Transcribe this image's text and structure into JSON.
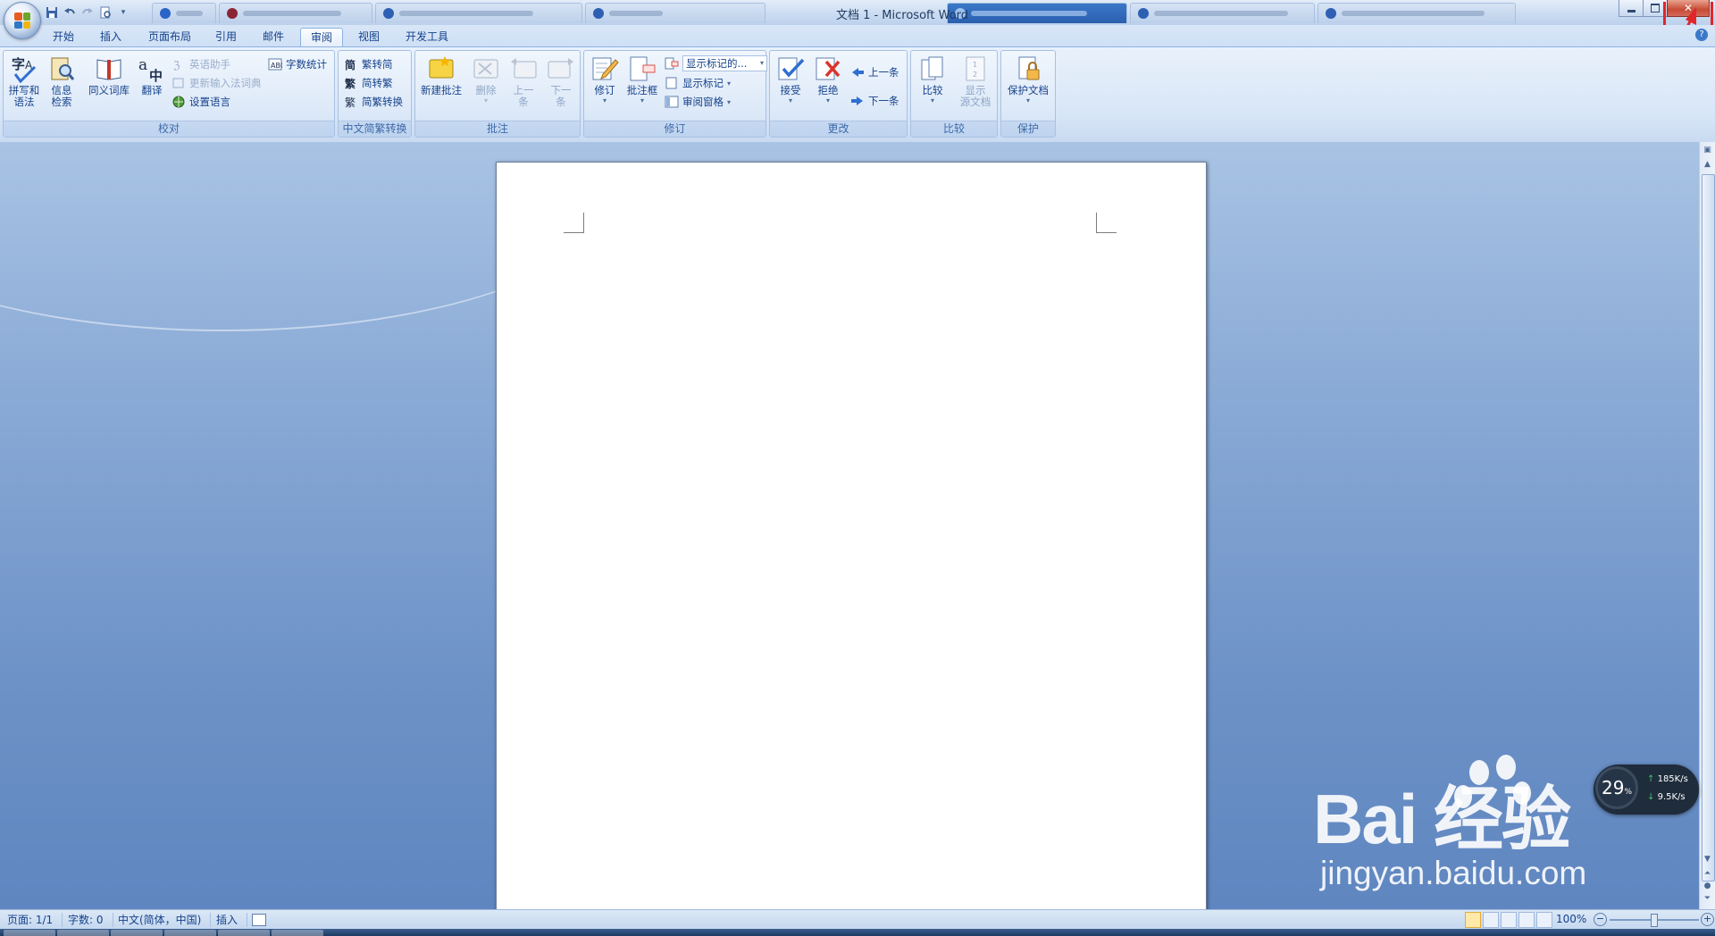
{
  "window": {
    "title": "文档 1 - Microsoft Word"
  },
  "tabs": [
    "开始",
    "插入",
    "页面布局",
    "引用",
    "邮件",
    "审阅",
    "视图",
    "开发工具"
  ],
  "active_tab": "审阅",
  "ribbon": {
    "proofing": {
      "label": "校对",
      "spelling": "拼写和\n语法",
      "research": "信息\n检索",
      "thesaurus": "同义词库",
      "translate": "翻译",
      "english_assistant": "英语助手",
      "update_ime": "更新输入法词典",
      "set_language": "设置语言",
      "word_count": "字数统计"
    },
    "chinese_conversion": {
      "label": "中文简繁转换",
      "to_simplified": "繁转简",
      "to_traditional": "简转繁",
      "conversion": "简繁转换"
    },
    "comments": {
      "label": "批注",
      "new_comment": "新建批注",
      "delete": "删除",
      "previous": "上一\n条",
      "next": "下一\n条"
    },
    "tracking": {
      "label": "修订",
      "track_changes": "修订",
      "balloons": "批注框",
      "display_for_review": "显示标记的...",
      "show_markup": "显示标记",
      "reviewing_pane": "审阅窗格"
    },
    "changes": {
      "label": "更改",
      "accept": "接受",
      "reject": "拒绝",
      "previous": "上一条",
      "next": "下一条"
    },
    "compare": {
      "label": "比较",
      "compare": "比较",
      "show_source": "显示\n源文档"
    },
    "protect": {
      "label": "保护",
      "protect_document": "保护文档"
    }
  },
  "status": {
    "page": "页面: 1/1",
    "words": "字数: 0",
    "language": "中文(简体，中国)",
    "mode": "插入",
    "zoom": "100%"
  },
  "net_widget": {
    "cpu": "29",
    "cpu_unit": "%",
    "upload": "185K/s",
    "download": "9.5K/s"
  },
  "watermark": {
    "brand": "Bai  经验",
    "url": "jingyan.baidu.com"
  },
  "colors": {
    "accent": "#15428b",
    "close_button": "#c74b35",
    "annotation": "#e0262b",
    "workspace": "#6d92c7"
  }
}
